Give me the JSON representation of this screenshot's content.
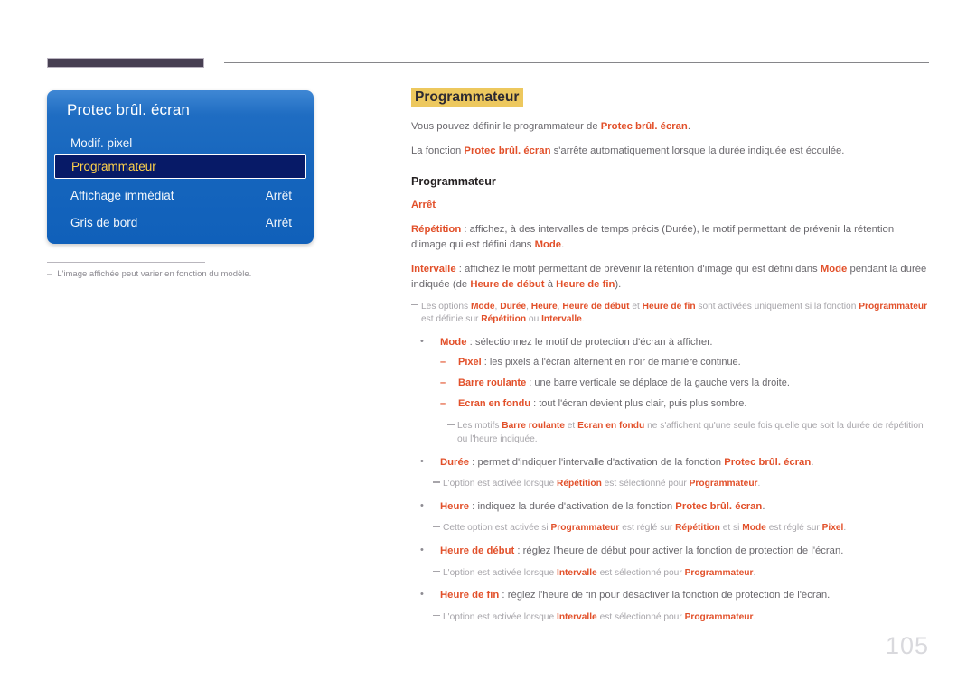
{
  "page": {
    "number": "105"
  },
  "osd": {
    "title": "Protec brûl. écran",
    "rows": [
      {
        "label": "Modif. pixel",
        "value": "",
        "selected": false
      },
      {
        "label": "Programmateur",
        "value": "",
        "selected": true
      },
      {
        "label": "Affichage immédiat",
        "value": "Arrêt",
        "selected": false
      },
      {
        "label": "Gris de bord",
        "value": "Arrêt",
        "selected": false
      }
    ]
  },
  "footnote": {
    "dash": "–",
    "text": "L'image affichée peut varier en fonction du modèle."
  },
  "content": {
    "section_title": "Programmateur",
    "intro_1": {
      "a": "Vous pouvez définir le programmateur de ",
      "kw": "Protec brûl. écran",
      "b": "."
    },
    "intro_2": {
      "a": "La fonction ",
      "kw": "Protec brûl. écran",
      "b": " s'arrête automatiquement lorsque la durée indiquée est écoulée."
    },
    "sub_head": "Programmateur",
    "opt_arret": "Arrêt",
    "opt_repetition": {
      "kw": "Répétition",
      "text": " : affichez, à des intervalles de temps précis (Durée), le motif permettant de prévenir la rétention d'image qui est défini dans ",
      "kw2": "Mode",
      "tail": "."
    },
    "opt_intervalle": {
      "kw": "Intervalle",
      "text": " : affichez le motif permettant de prévenir la rétention d'image qui est défini dans ",
      "kw2": "Mode",
      "text2": " pendant la durée indiquée (de ",
      "kw3": "Heure de début",
      "text3": " à ",
      "kw4": "Heure de fin",
      "tail": ")."
    },
    "note_options": {
      "p1": "Les options ",
      "k1": "Mode",
      "p2": ", ",
      "k2": "Durée",
      "p3": ", ",
      "k3": "Heure",
      "p4": ", ",
      "k4": "Heure de début",
      "p5": " et ",
      "k5": "Heure de fin",
      "p6": " sont activées uniquement si la fonction ",
      "k6": "Programmateur",
      "p7": " est définie sur ",
      "k7": "Répétition",
      "p8": " ou ",
      "k8": "Intervalle",
      "p9": "."
    },
    "bullet_mode": {
      "kw": "Mode",
      "text": " : sélectionnez le motif de protection d'écran à afficher."
    },
    "sub_pixel": {
      "kw": "Pixel",
      "text": " : les pixels à l'écran alternent en noir de manière continue."
    },
    "sub_barre": {
      "kw": "Barre roulante",
      "text": " : une barre verticale se déplace de la gauche vers la droite."
    },
    "sub_fondu": {
      "kw": "Ecran en fondu",
      "text": " : tout l'écran devient plus clair, puis plus sombre."
    },
    "note_motifs": {
      "p1": "Les motifs ",
      "k1": "Barre roulante",
      "p2": " et ",
      "k2": "Ecran en fondu",
      "p3": " ne s'affichent qu'une seule fois quelle que soit la durée de répétition ou l'heure indiquée."
    },
    "bullet_duree": {
      "kw": "Durée",
      "text": " : permet d'indiquer l'intervalle d'activation de la fonction ",
      "kw2": "Protec brûl. écran",
      "tail": "."
    },
    "note_duree": {
      "p1": "L'option est activée lorsque ",
      "k1": "Répétition",
      "p2": " est sélectionné pour ",
      "k2": "Programmateur",
      "p3": "."
    },
    "bullet_heure": {
      "kw": "Heure",
      "text": " : indiquez la durée d'activation de la fonction ",
      "kw2": "Protec brûl. écran",
      "tail": "."
    },
    "note_heure": {
      "p1": "Cette option est activée si ",
      "k1": "Programmateur",
      "p2": " est réglé sur ",
      "k2": "Répétition",
      "p3": " et si ",
      "k3": "Mode",
      "p4": " est réglé sur ",
      "k4": "Pixel",
      "p5": "."
    },
    "bullet_debut": {
      "kw": "Heure de début",
      "text": " : réglez l'heure de début pour activer la fonction de protection de l'écran."
    },
    "note_debut": {
      "p1": "L'option est activée lorsque ",
      "k1": "Intervalle",
      "p2": " est sélectionné pour ",
      "k2": "Programmateur",
      "p3": "."
    },
    "bullet_fin": {
      "kw": "Heure de fin",
      "text": " : réglez l'heure de fin pour désactiver la fonction de protection de l'écran."
    },
    "note_fin": {
      "p1": "L'option est activée lorsque ",
      "k1": "Intervalle",
      "p2": " est sélectionné pour ",
      "k2": "Programmateur",
      "p3": "."
    }
  },
  "icons": {
    "bullet_dot": "•",
    "bullet_dash": "–"
  }
}
